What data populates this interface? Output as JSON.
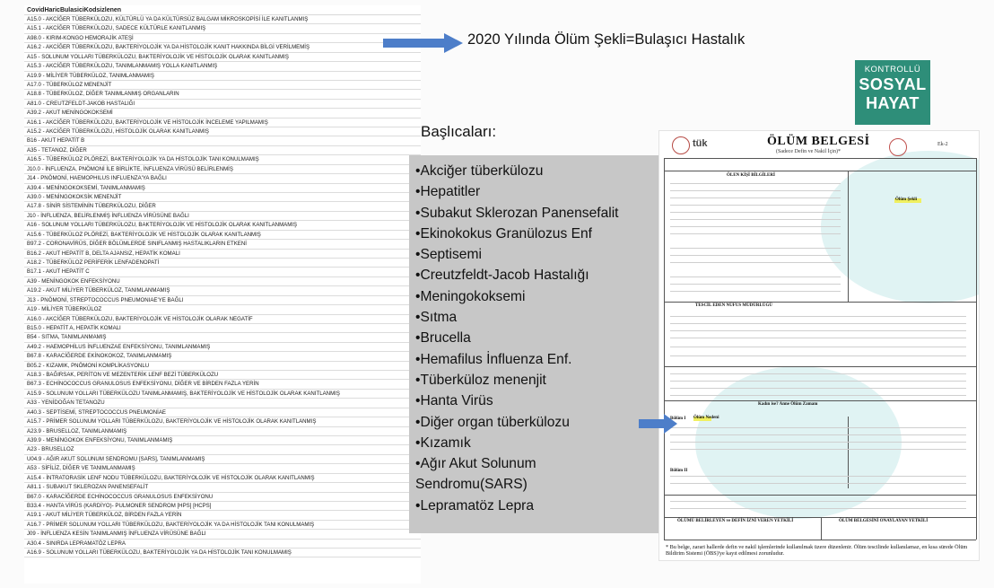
{
  "icd_list": {
    "header": "CovidHaricBulasiciKodsizlenen",
    "rows": [
      "A15.0 - AKCİĞER TÜBERKÜLOZU, KÜLTÜRLÜ YA DA KÜLTÜRSÜZ BALGAM MİKROSKOPİSİ İLE KANITLANMIŞ",
      "A15.1 - AKCİĞER TÜBERKÜLOZU, SADECE KÜLTÜRLE KANITLANMIŞ",
      "A98.0 - KIRIM-KONGO HEMORAJİK ATEŞİ",
      "A16.2 - AKCİĞER TÜBERKÜLOZU, BAKTERİYOLOJİK YA DA HİSTOLOJİK KANIT HAKKINDA BİLGİ VERİLMEMİŞ",
      "A15 - SOLUNUM YOLLARI TÜBERKÜLOZU, BAKTERİYOLOJİK VE HİSTOLOJİK OLARAK KANITLANMIŞ",
      "A15.3 - AKCİĞER TÜBERKÜLOZU, TANIMLANMAMIŞ YOLLA KANITLANMIŞ",
      "A19.9 - MİLİYER TÜBERKÜLOZ, TANIMLANMAMIŞ",
      "A17.0 - TÜBERKÜLOZ MENENJİT",
      "A18.8 - TÜBERKÜLOZ, DİĞER TANIMLANMIŞ ORGANLARIN",
      "A81.0 - CREUTZFELDT-JAKOB HASTALIĞI",
      "A39.2 - AKUT MENİNGOKOKSEMİ",
      "A16.1 - AKCİĞER TÜBERKÜLOZU, BAKTERİYOLOJİK VE HİSTOLOJİK İNCELEME YAPILMAMIŞ",
      "A15.2 - AKCİĞER TÜBERKÜLOZU, HİSTOLOJİK OLARAK KANITLANMIŞ",
      "B16 - AKUT HEPATİT B",
      "A35 - TETANOZ, DİĞER",
      "A16.5 - TÜBERKÜLOZ PLÖREZİ, BAKTERİYOLOJİK YA DA HİSTOLOJİK TANI KONULMAMIŞ",
      "J10.0 - İNFLUENZA, PNÖMONİ İLE BİRLİKTE, İNFLUENZA VİRÜSÜ BELİRLENMİŞ",
      "J14 - PNÖMONİ, HAEMOPHILUS INFLUENZA'YA BAĞLI",
      "A39.4 - MENİNGOKOKSEMİ, TANIMLANMAMIŞ",
      "A39.0 - MENİNGOKOKSİK MENENJİT",
      "A17.8 - SİNİR SİSTEMİNİN TÜBERKÜLOZU, DİĞER",
      "J10 - İNFLUENZA, BELİRLENMİŞ İNFLUENZA VİRÜSÜNE BAĞLI",
      "A16 - SOLUNUM YOLLARI TÜBERKÜLOZU, BAKTERİYOLOJİK VE HİSTOLOJİK OLARAK KANITLANMAMIŞ",
      "A15.6 - TÜBERKÜLOZ PLÖREZİ, BAKTERİYOLOJİK VE HİSTOLOJİK OLARAK KANITLANMIŞ",
      "B97.2 - CORONAVİRÜS, DİĞER BÖLÜMLERDE SINIFLANMIŞ HASTALIKLARIN ETKENİ",
      "B16.2 - AKUT HEPATİT B, DELTA AJANSIZ, HEPATİK KOMALI",
      "A18.2 - TÜBERKÜLOZ PERİFERİK LENFADENOPATİ",
      "B17.1 - AKUT HEPATİT C",
      "A39 - MENİNGOKOK ENFEKSİYONU",
      "A19.2 - AKUT MİLİYER TÜBERKÜLOZ, TANIMLANMAMIŞ",
      "J13 - PNÖMONİ, STREPTOCOCCUS PNEUMONIAE'YE BAĞLI",
      "A19 - MİLİYER TÜBERKÜLOZ",
      "A16.0 - AKCİĞER TÜBERKÜLOZU, BAKTERİYOLOJİK VE HİSTOLOJİK OLARAK NEGATİF",
      "B15.0 - HEPATİT A, HEPATİK KOMALI",
      "B54 - SITMA, TANIMLANMAMIŞ",
      "A49.2 - HAEMOPHİLUS İNFLUENZAE ENFEKSİYONU, TANIMLANMAMIŞ",
      "B67.8 - KARACİĞERDE EKİNOKOKOZ, TANIMLANMAMIŞ",
      "B05.2 - KIZAMIK, PNÖMONİ KOMPLİKASYONLU",
      "A18.3 - BAĞIRSAK, PERİTON VE MEZENTERİK LENF BEZİ TÜBERKÜLOZU",
      "B67.3 - ECHİNOCOCCUS GRANULOSUS ENFEKSİYONU, DİĞER VE BİRDEN FAZLA YERİN",
      "A15.9 - SOLUNUM YOLLARI TÜBERKÜLOZU TANIMLANMAMIŞ, BAKTERİYOLOJİK VE HİSTOLOJİK OLARAK KANITLANMIŞ",
      "A33 - YENİDOĞAN TETANOZU",
      "A40.3 - SEPTİSEMİ, STREPTOCOCCUS PNEUMONİAE",
      "A15.7 - PRİMER SOLUNUM YOLLARI TÜBERKÜLOZU, BAKTERİYOLOJİK VE HİSTOLOJİK OLARAK KANITLANMIŞ",
      "A23.9 - BRUSELLOZ, TANIMLANMAMIŞ",
      "A39.9 - MENİNGOKOK ENFEKSİYONU, TANIMLANMAMIŞ",
      "A23 - BRUSELLOZ",
      "U04.9 - AĞIR AKUT SOLUNUM SENDROMU [SARS], TANIMLANMAMIŞ",
      "A53 - SİFİLİZ, DİĞER VE TANIMLANMAMIŞ",
      "A15.4 - İNTRATORASİK LENF NODU TÜBERKÜLOZU, BAKTERİYOLOJİK VE HİSTOLOJİK OLARAK KANITLANMIŞ",
      "A81.1 - SUBAKUT SKLEROZAN PANENSEFALİT",
      "B67.0 - KARACİĞERDE ECHİNOCOCCUS GRANULOSUS ENFEKSİYONU",
      "B33.4 - HANTA VİRÜS (KARDİYO)- PULMONER SENDROM [HPS] [HCPS]",
      "A19.1 - AKUT MİLİYER TÜBERKÜLOZ, BİRDEN FAZLA YERİN",
      "A16.7 - PRİMER SOLUNUM YOLLARI TÜBERKÜLOZU, BAKTERİYOLOJİK YA DA HİSTOLOJİK TANI KONULMAMIŞ",
      "J09 - İNFLUENZA KESİN TANIMLANMIŞ İNFLUENZA VİRÜSÜNE BAĞLI",
      "A30.4 - SINIRDA LEPRAMATÖZ LEPRA",
      "A16.9 - SOLUNUM YOLLARI TÜBERKÜLOZU, BAKTERİYOLOJİK YA DA HİSTOLOJİK TANI KONULMAMIŞ"
    ]
  },
  "headline": "2020 Yılında Ölüm Şekli=Bulaşıcı Hastalık",
  "logo": {
    "line1": "KONTROLLÜ",
    "line2": "SOSYAL",
    "line3": "HAYAT",
    "color": "#2e8e79"
  },
  "main_heading": "Başlıcaları:",
  "causes": [
    "•Akciğer tüberkülozu",
    "•Hepatitler",
    "•Subakut Sklerozan Panensefalit",
    "•Ekinokokus Granülozus Enf",
    "•Septisemi",
    "•Creutzfeldt-Jacob Hastalığı",
    "•Meningokoksemi",
    "•Sıtma",
    "•Brucella",
    "•Hemafilus İnfluenza Enf.",
    "•Tüberküloz menenjit",
    "•Hanta Virüs",
    "•Diğer organ tüberkülozu",
    "•Kızamık",
    "•Ağır Akut Solunum",
    "Sendromu(SARS)",
    "•Lepramatöz Lepra"
  ],
  "doc": {
    "mark": "tük",
    "title": "ÖLÜM BELGESİ",
    "subtitle": "(Sadece Defin ve Nakil İçin)*",
    "code": "Ek-2",
    "section_a": "ÖLEN KİŞİ BİLGİLERİ",
    "section_b": "Ölüm Şekli",
    "section_c": "TESCİL EDEN NÜFUS MÜDÜRLÜĞÜ",
    "section_d": "Kadın ise? Anne Ölüm Zamanı",
    "bolum1": "Bölüm I",
    "bolum2": "Bölüm II",
    "olum_nedeni": "Ölüm Nedeni",
    "footer_left": "ÖLÜMÜ BELİRLEYEN ve DEFİN İZNİ VEREN YETKİLİ",
    "footer_right": "ÖLÜM BELGESİNİ ONAYLAYAN YETKİLİ",
    "footnote": "* Bu belge, zarari hallerde defin ve nakil işlemlerinde kullanılmak üzere düzenlenir. Ölüm tescilinde kullanılamaz, en kısa sürede Ölüm Bildirim Sistemi (ÖBS)'ye kayıt edilmesi zorunludur."
  },
  "colors": {
    "cause_box": "#c7c7c7",
    "arrow": "#4d7ec9",
    "circle": "#a5dede"
  }
}
